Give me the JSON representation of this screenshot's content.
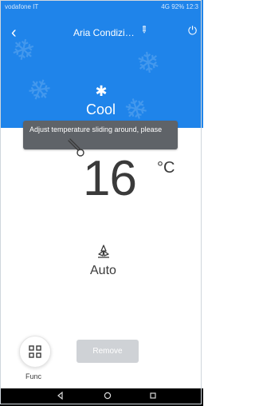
{
  "status": {
    "left": "vodafone IT",
    "right": "4G 92% 12:3"
  },
  "header": {
    "title": "Aria Condizi…",
    "bg_color": "#1f84ea"
  },
  "mode": {
    "label": "Cool",
    "icon": "snowflake-icon"
  },
  "toast": {
    "text": "Adjust temperature sliding around, please"
  },
  "temperature": {
    "value": "16",
    "unit": "°C"
  },
  "fan": {
    "label": "Auto",
    "icon": "fan-icon"
  },
  "bottom": {
    "func_label": "Func",
    "remove_label": "Remove"
  },
  "colors": {
    "accent": "#1f84ea",
    "toast_bg": "#5f6368",
    "remove_bg": "#cfd2d6"
  }
}
